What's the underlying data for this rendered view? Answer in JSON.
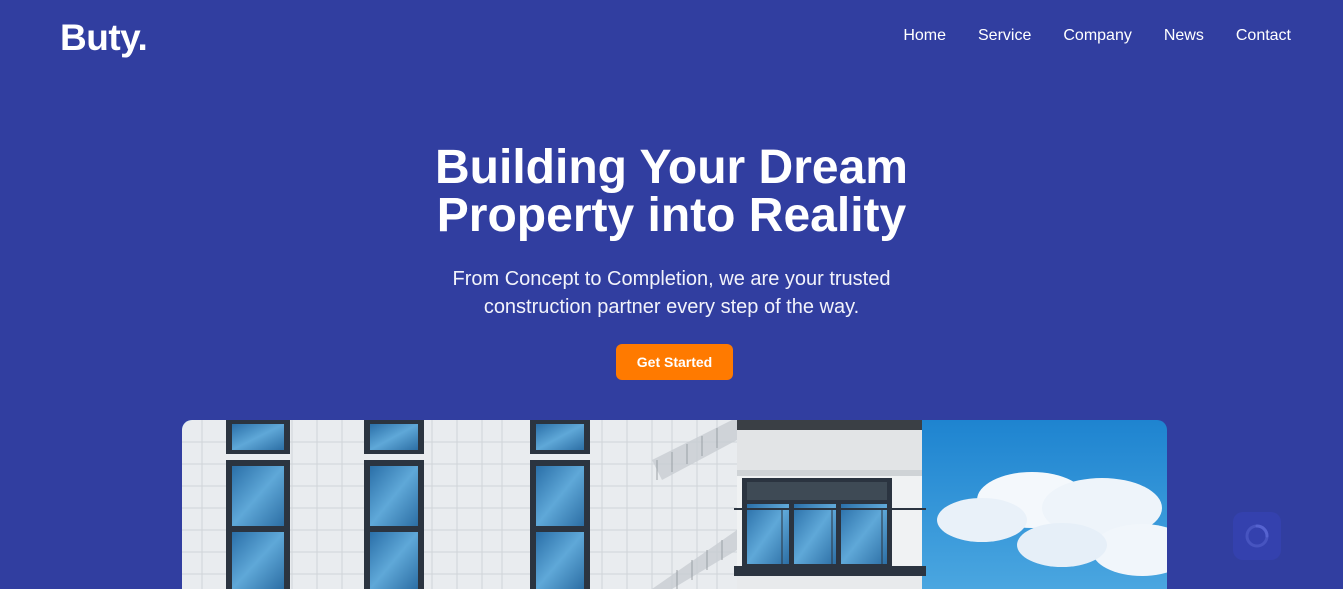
{
  "header": {
    "logo": "Buty.",
    "nav": [
      {
        "label": "Home"
      },
      {
        "label": "Service"
      },
      {
        "label": "Company"
      },
      {
        "label": "News"
      },
      {
        "label": "Contact"
      }
    ]
  },
  "hero": {
    "title_lines": [
      "Building Your Dream",
      "Property into Reality"
    ],
    "subtitle_lines": [
      "From Concept to Completion, we are your trusted",
      "construction partner every step of the way."
    ],
    "cta_label": "Get Started"
  },
  "colors": {
    "background": "#313ea0",
    "accent": "#ff7a00",
    "text": "#ffffff"
  },
  "icons": {
    "floating_widget": "spinner-icon"
  }
}
